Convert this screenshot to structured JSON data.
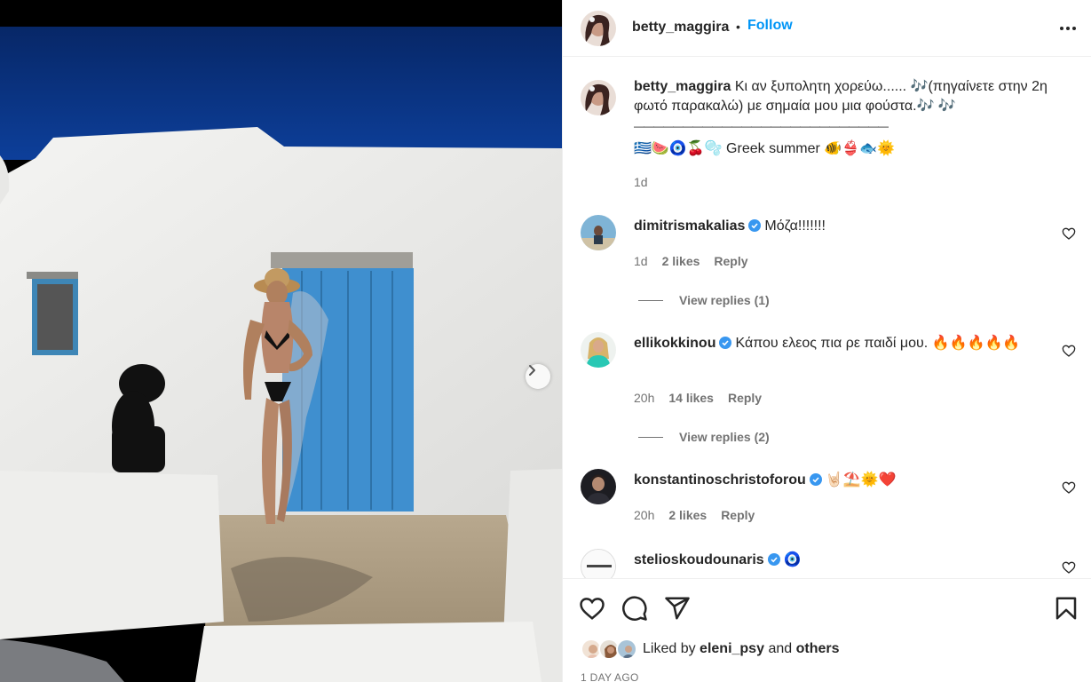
{
  "post": {
    "author": "betty_maggira",
    "follow_label": "Follow",
    "separator": "•",
    "caption": {
      "text": "Κι αν ξυπολητη χορεύω...... 🎶(πηγαίνετε στην 2η φωτό παρακαλώ) με σημαία μου μια φούστα.🎶 🎶",
      "rule": "——————————————————————————",
      "tags": "🇬🇷🍉🧿🍒🫧 Greek summer 🐠👙🐟🌞",
      "time": "1d"
    }
  },
  "comments": [
    {
      "user": "dimitrismakalias",
      "verified": true,
      "text": "Μόζα!!!!!!!",
      "time": "1d",
      "likes": "2 likes",
      "reply_label": "Reply",
      "view_replies": "View replies (1)"
    },
    {
      "user": "ellikokkinou",
      "verified": true,
      "text": "Κάπου ελεος πια ρε παιδί μου. 🔥🔥🔥🔥🔥",
      "time": "20h",
      "likes": "14 likes",
      "reply_label": "Reply",
      "view_replies": "View replies (2)"
    },
    {
      "user": "konstantinoschristoforou",
      "verified": true,
      "text": "🤘🏻⛱️🌞❤️",
      "time": "20h",
      "likes": "2 likes",
      "reply_label": "Reply"
    },
    {
      "user": "stelioskoudounaris",
      "verified": true,
      "text": "🧿"
    }
  ],
  "liked_by": {
    "prefix": "Liked by",
    "user": "eleni_psy",
    "conj": "and",
    "others": "others"
  },
  "date": "1 DAY AGO",
  "colors": {
    "follow": "#0095f6",
    "verified": "#3897f0",
    "door": "#3f8fcf",
    "sky": "#0a2f7a"
  },
  "icons": [
    "more-icon",
    "heart-icon",
    "comment-icon",
    "share-icon",
    "save-icon",
    "verified-icon",
    "chevron-right-icon"
  ]
}
